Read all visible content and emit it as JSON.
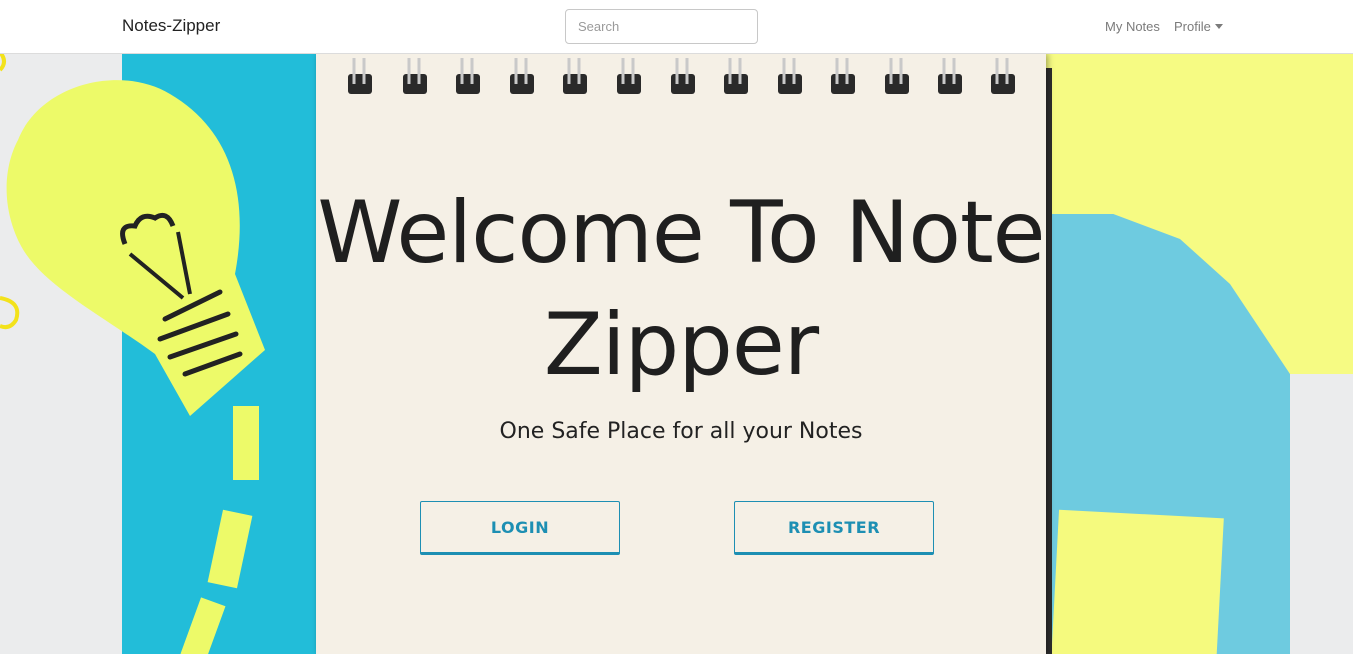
{
  "navbar": {
    "brand": "Notes-Zipper",
    "search_placeholder": "Search",
    "links": {
      "my_notes": "My Notes",
      "profile": "Profile"
    }
  },
  "hero": {
    "title": "Welcome To Note Zipper",
    "subtitle": "One Safe Place for all your Notes",
    "login_label": "LOGIN",
    "register_label": "REGISTER"
  },
  "colors": {
    "accent": "#1d8fb3",
    "navbar_bg": "#ffffff",
    "paper": "#f5f0e6",
    "sticky_yellow": "#f6fb83",
    "paper_blue": "#22bdd9"
  },
  "icons": {
    "profile_dropdown": "caret-down-icon"
  }
}
